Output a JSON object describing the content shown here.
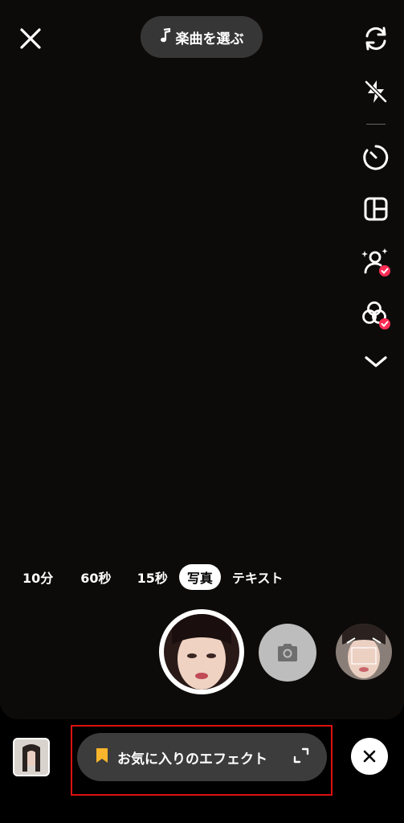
{
  "top": {
    "music_label": "楽曲を選ぶ"
  },
  "side_icons": [
    "flip-camera-icon",
    "flash-off-icon",
    "timer-icon",
    "layout-grid-icon",
    "enhance-person-icon",
    "filters-icon",
    "chevron-down-icon"
  ],
  "modes": {
    "items": [
      "10分",
      "60秒",
      "15秒",
      "写真",
      "テキスト"
    ],
    "selected": "写真"
  },
  "bottom": {
    "favorites_label": "お気に入りのエフェクト"
  },
  "colors": {
    "accent": "#fe2c55",
    "bookmark": "#f9b52c",
    "highlight_border": "#dd1111"
  }
}
